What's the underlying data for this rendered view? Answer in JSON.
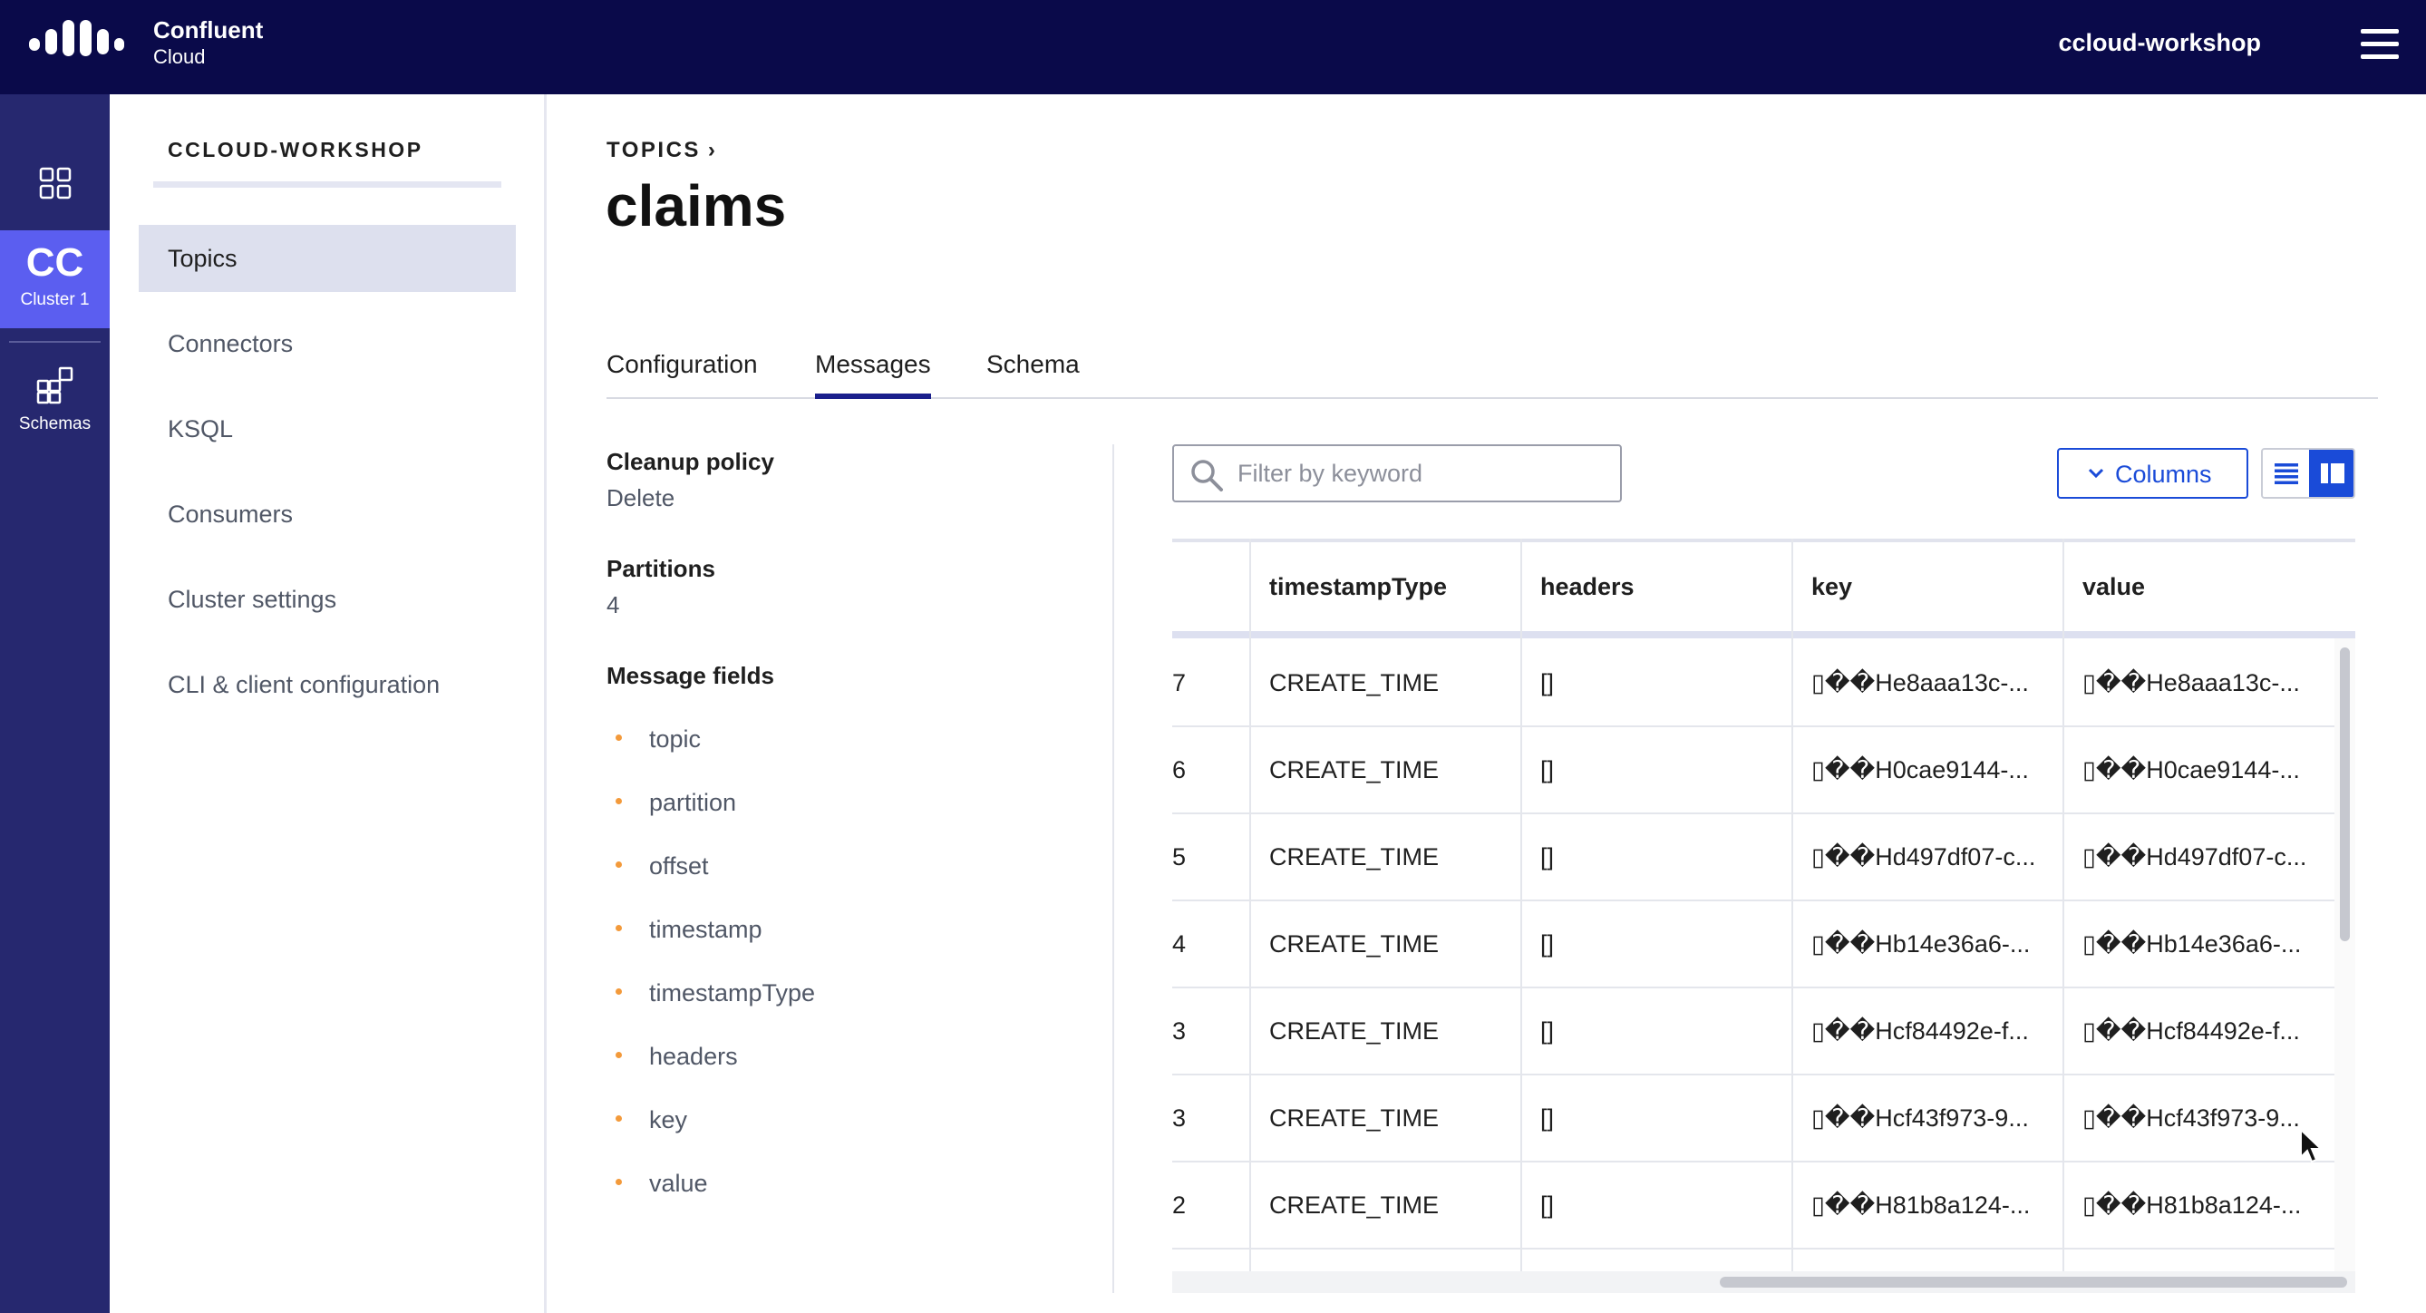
{
  "header": {
    "brand_name": "Confluent",
    "brand_sub": "Cloud",
    "environment": "ccloud-workshop",
    "menu_icon": "hamburger-menu-icon"
  },
  "rail": {
    "dashboard_icon": "grid-dashboard-icon",
    "cluster_abbr": "CC",
    "cluster_label": "Cluster 1",
    "schemas_label": "Schemas",
    "schemas_icon": "schemas-icon"
  },
  "sidebar": {
    "cluster_name": "CCLOUD-WORKSHOP",
    "items": [
      {
        "label": "Topics",
        "active": true
      },
      {
        "label": "Connectors",
        "active": false
      },
      {
        "label": "KSQL",
        "active": false
      },
      {
        "label": "Consumers",
        "active": false
      },
      {
        "label": "Cluster settings",
        "active": false
      },
      {
        "label": "CLI & client configuration",
        "active": false
      }
    ]
  },
  "main": {
    "breadcrumb": "TOPICS",
    "title": "claims",
    "tabs": [
      {
        "label": "Configuration",
        "active": false
      },
      {
        "label": "Messages",
        "active": true
      },
      {
        "label": "Schema",
        "active": false
      }
    ],
    "details": {
      "cleanup_label": "Cleanup policy",
      "cleanup_value": "Delete",
      "partitions_label": "Partitions",
      "partitions_value": "4",
      "fields_label": "Message fields",
      "fields": [
        "topic",
        "partition",
        "offset",
        "timestamp",
        "timestampType",
        "headers",
        "key",
        "value"
      ]
    },
    "toolbar": {
      "filter_placeholder": "Filter by keyword",
      "columns_label": "Columns"
    },
    "table": {
      "columns": [
        "",
        "timestampType",
        "headers",
        "key",
        "value"
      ],
      "rows": [
        [
          "7",
          "CREATE_TIME",
          "[]",
          "▯��He8aaa13c-...",
          "▯��He8aaa13c-..."
        ],
        [
          "6",
          "CREATE_TIME",
          "[]",
          "▯��H0cae9144-...",
          "▯��H0cae9144-..."
        ],
        [
          "5",
          "CREATE_TIME",
          "[]",
          "▯��Hd497df07-c...",
          "▯��Hd497df07-c..."
        ],
        [
          "4",
          "CREATE_TIME",
          "[]",
          "▯��Hb14e36a6-...",
          "▯��Hb14e36a6-..."
        ],
        [
          "3",
          "CREATE_TIME",
          "[]",
          "▯��Hcf84492e-f...",
          "▯��Hcf84492e-f..."
        ],
        [
          "3",
          "CREATE_TIME",
          "[]",
          "▯��Hcf43f973-9...",
          "▯��Hcf43f973-9..."
        ],
        [
          "2",
          "CREATE_TIME",
          "[]",
          "▯��H81b8a124-...",
          "▯��H81b8a124-..."
        ]
      ]
    }
  },
  "colors": {
    "topbar": "#0a0a4a",
    "rail": "#26286f",
    "rail_active": "#5b5ef0",
    "accent_blue": "#1a4bd8",
    "tab_underline": "#1a1f8c",
    "bullet": "#f39a3b"
  }
}
